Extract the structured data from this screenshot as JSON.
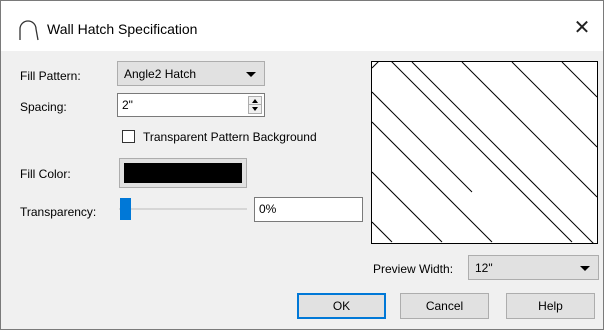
{
  "window": {
    "title": "Wall Hatch Specification",
    "close_glyph": "✕"
  },
  "fields": {
    "fill_pattern_label": "Fill Pattern:",
    "fill_pattern_value": "Angle2 Hatch",
    "spacing_label": "Spacing:",
    "spacing_value": "2\"",
    "transparent_bg_label": "Transparent Pattern Background",
    "transparent_bg_checked": false,
    "fill_color_label": "Fill Color:",
    "fill_color_value": "#000000",
    "transparency_label": "Transparency:",
    "transparency_value": "0%",
    "transparency_level": 0
  },
  "preview": {
    "width_label": "Preview Width:",
    "width_value": "12\"",
    "pattern": "angle2-hatch-diagonal-lines"
  },
  "buttons": {
    "ok": "OK",
    "cancel": "Cancel",
    "help": "Help"
  },
  "colors": {
    "accent": "#0078d7",
    "dialog_bg": "#f0f0f0",
    "button_bg": "#e1e1e1"
  },
  "icons": {
    "title": "wall-arc-icon",
    "close": "close-icon"
  }
}
